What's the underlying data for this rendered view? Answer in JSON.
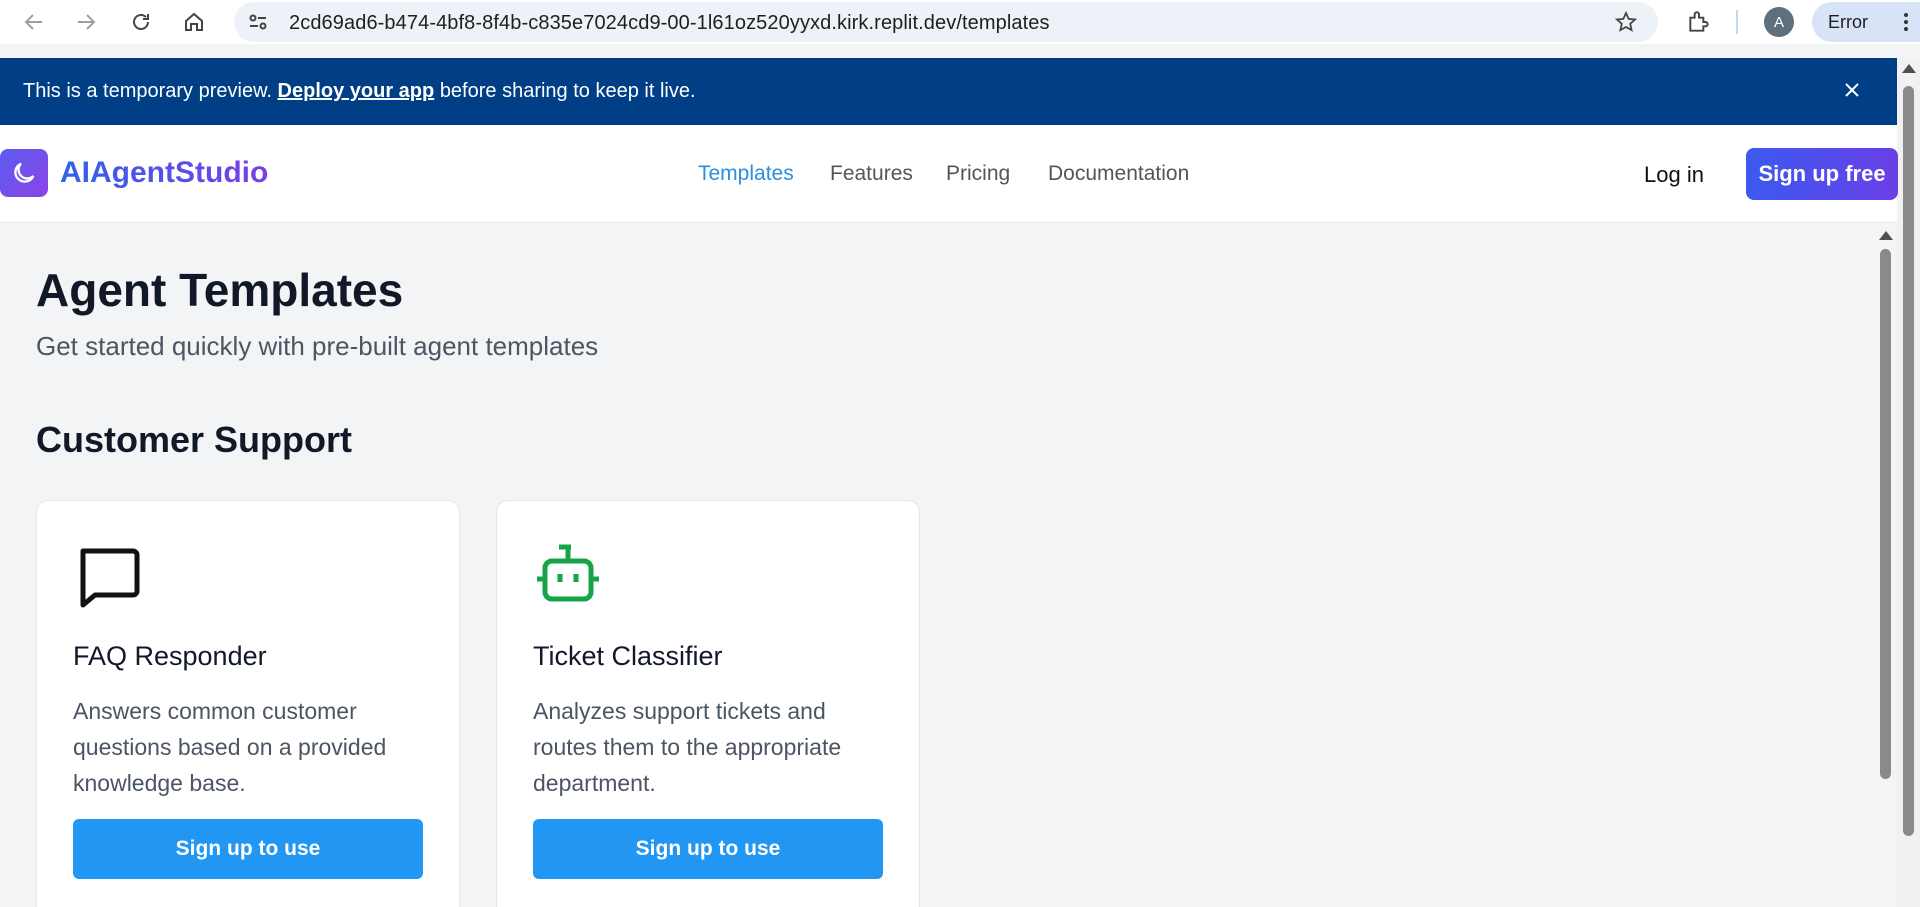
{
  "browser": {
    "url": "2cd69ad6-b474-4bf8-8f4b-c835e7024cd9-00-1l61oz520yyxd.kirk.replit.dev/templates",
    "profile_initial": "A",
    "error_label": "Error",
    "icons": [
      "back-icon",
      "forward-icon",
      "reload-icon",
      "home-icon",
      "site-info-icon",
      "star-icon",
      "extensions-icon",
      "more-icon"
    ]
  },
  "banner": {
    "text_before": "This is a temporary preview.",
    "link": "Deploy your app",
    "text_after": "before sharing to keep it live.",
    "background": "#003f85"
  },
  "header": {
    "brand": "AIAgentStudio",
    "nav": [
      {
        "label": "Templates",
        "active": true
      },
      {
        "label": "Features",
        "active": false
      },
      {
        "label": "Pricing",
        "active": false
      },
      {
        "label": "Documentation",
        "active": false
      }
    ],
    "login": "Log in",
    "signup": "Sign up free",
    "accent": "#2b8fe0"
  },
  "main": {
    "title": "Agent Templates",
    "subtitle": "Get started quickly with pre-built agent templates",
    "section": "Customer Support",
    "cards": [
      {
        "icon": "message-square-icon",
        "title": "FAQ Responder",
        "description": "Answers common customer questions based on a provided knowledge base.",
        "button": "Sign up to use"
      },
      {
        "icon": "bot-icon",
        "title": "Ticket Classifier",
        "description": "Analyzes support tickets and routes them to the appropriate department.",
        "button": "Sign up to use"
      }
    ],
    "button_color": "#2196f3",
    "bot_icon_color": "#16a34a"
  }
}
